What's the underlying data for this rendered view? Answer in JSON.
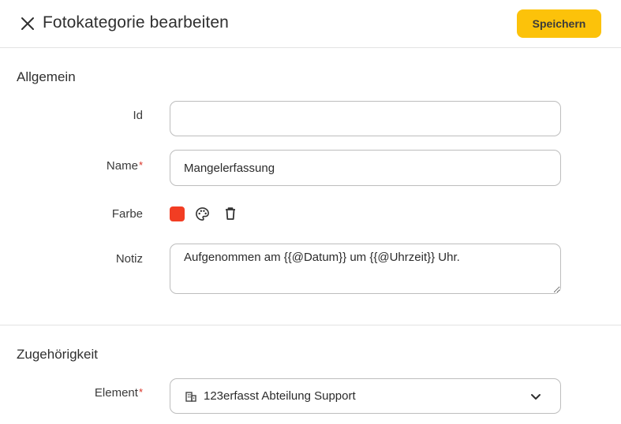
{
  "header": {
    "title": "Fotokategorie bearbeiten",
    "save_label": "Speichern",
    "close_icon": "close-icon"
  },
  "general": {
    "section_title": "Allgemein",
    "id": {
      "label": "Id",
      "value": ""
    },
    "name": {
      "label": "Name",
      "required_mark": "*",
      "value": "Mangelerfassung"
    },
    "color": {
      "label": "Farbe",
      "value": "#f23d23",
      "palette_icon": "palette-icon",
      "delete_icon": "trash-icon"
    },
    "note": {
      "label": "Notiz",
      "value": "Aufgenommen am {{@Datum}} um {{@Uhrzeit}} Uhr."
    }
  },
  "membership": {
    "section_title": "Zugehörigkeit",
    "element": {
      "label": "Element",
      "required_mark": "*",
      "value": "123erfasst Abteilung Support",
      "icon": "building-icon",
      "chevron_icon": "chevron-down-icon"
    }
  },
  "colors": {
    "accent": "#fcc20a",
    "required": "#d93025",
    "border": "#bdbdbd"
  }
}
